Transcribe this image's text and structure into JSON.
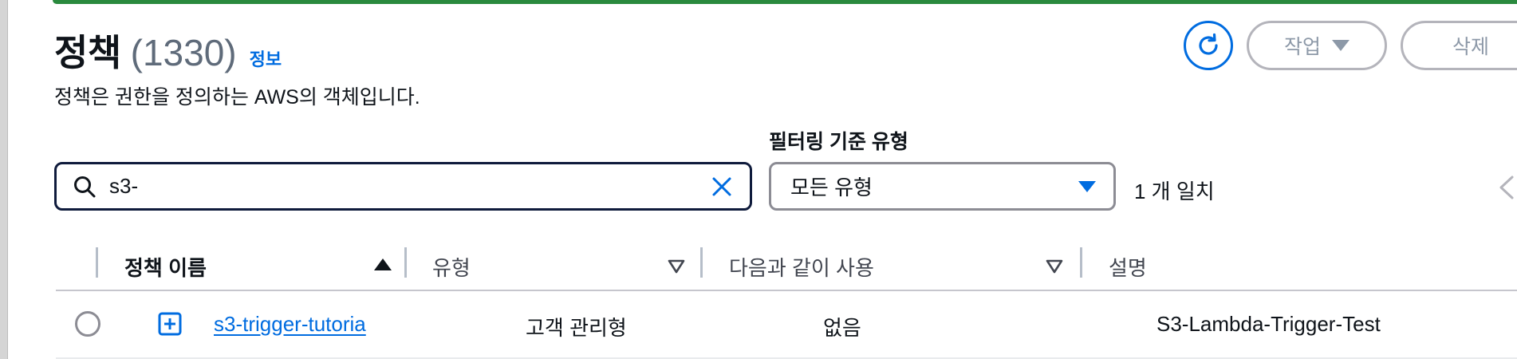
{
  "header": {
    "title": "정책",
    "count": "(1330)",
    "info_link": "정보",
    "description": "정책은 권한을 정의하는 AWS의 객체입니다."
  },
  "toolbar": {
    "refresh_icon": "refresh-icon",
    "actions_label": "작업",
    "delete_label": "삭제"
  },
  "filter": {
    "search_value": "s3-",
    "type_label": "필터링 기준 유형",
    "type_selected": "모든 유형",
    "match_count": "1 개 일치"
  },
  "table": {
    "columns": [
      {
        "label": "정책 이름",
        "sort": "ascending"
      },
      {
        "label": "유형",
        "sort": "descending"
      },
      {
        "label": "다음과 같이 사용",
        "sort": "descending"
      },
      {
        "label": "설명"
      }
    ],
    "rows": [
      {
        "name": "s3-trigger-tutoria",
        "type": "고객 관리형",
        "used_as": "없음",
        "description": "S3-Lambda-Trigger-Test"
      }
    ]
  },
  "colors": {
    "accent": "#006ce0",
    "banner": "#2a8a3e",
    "text": "#0f141a",
    "muted": "#8d99a8"
  }
}
